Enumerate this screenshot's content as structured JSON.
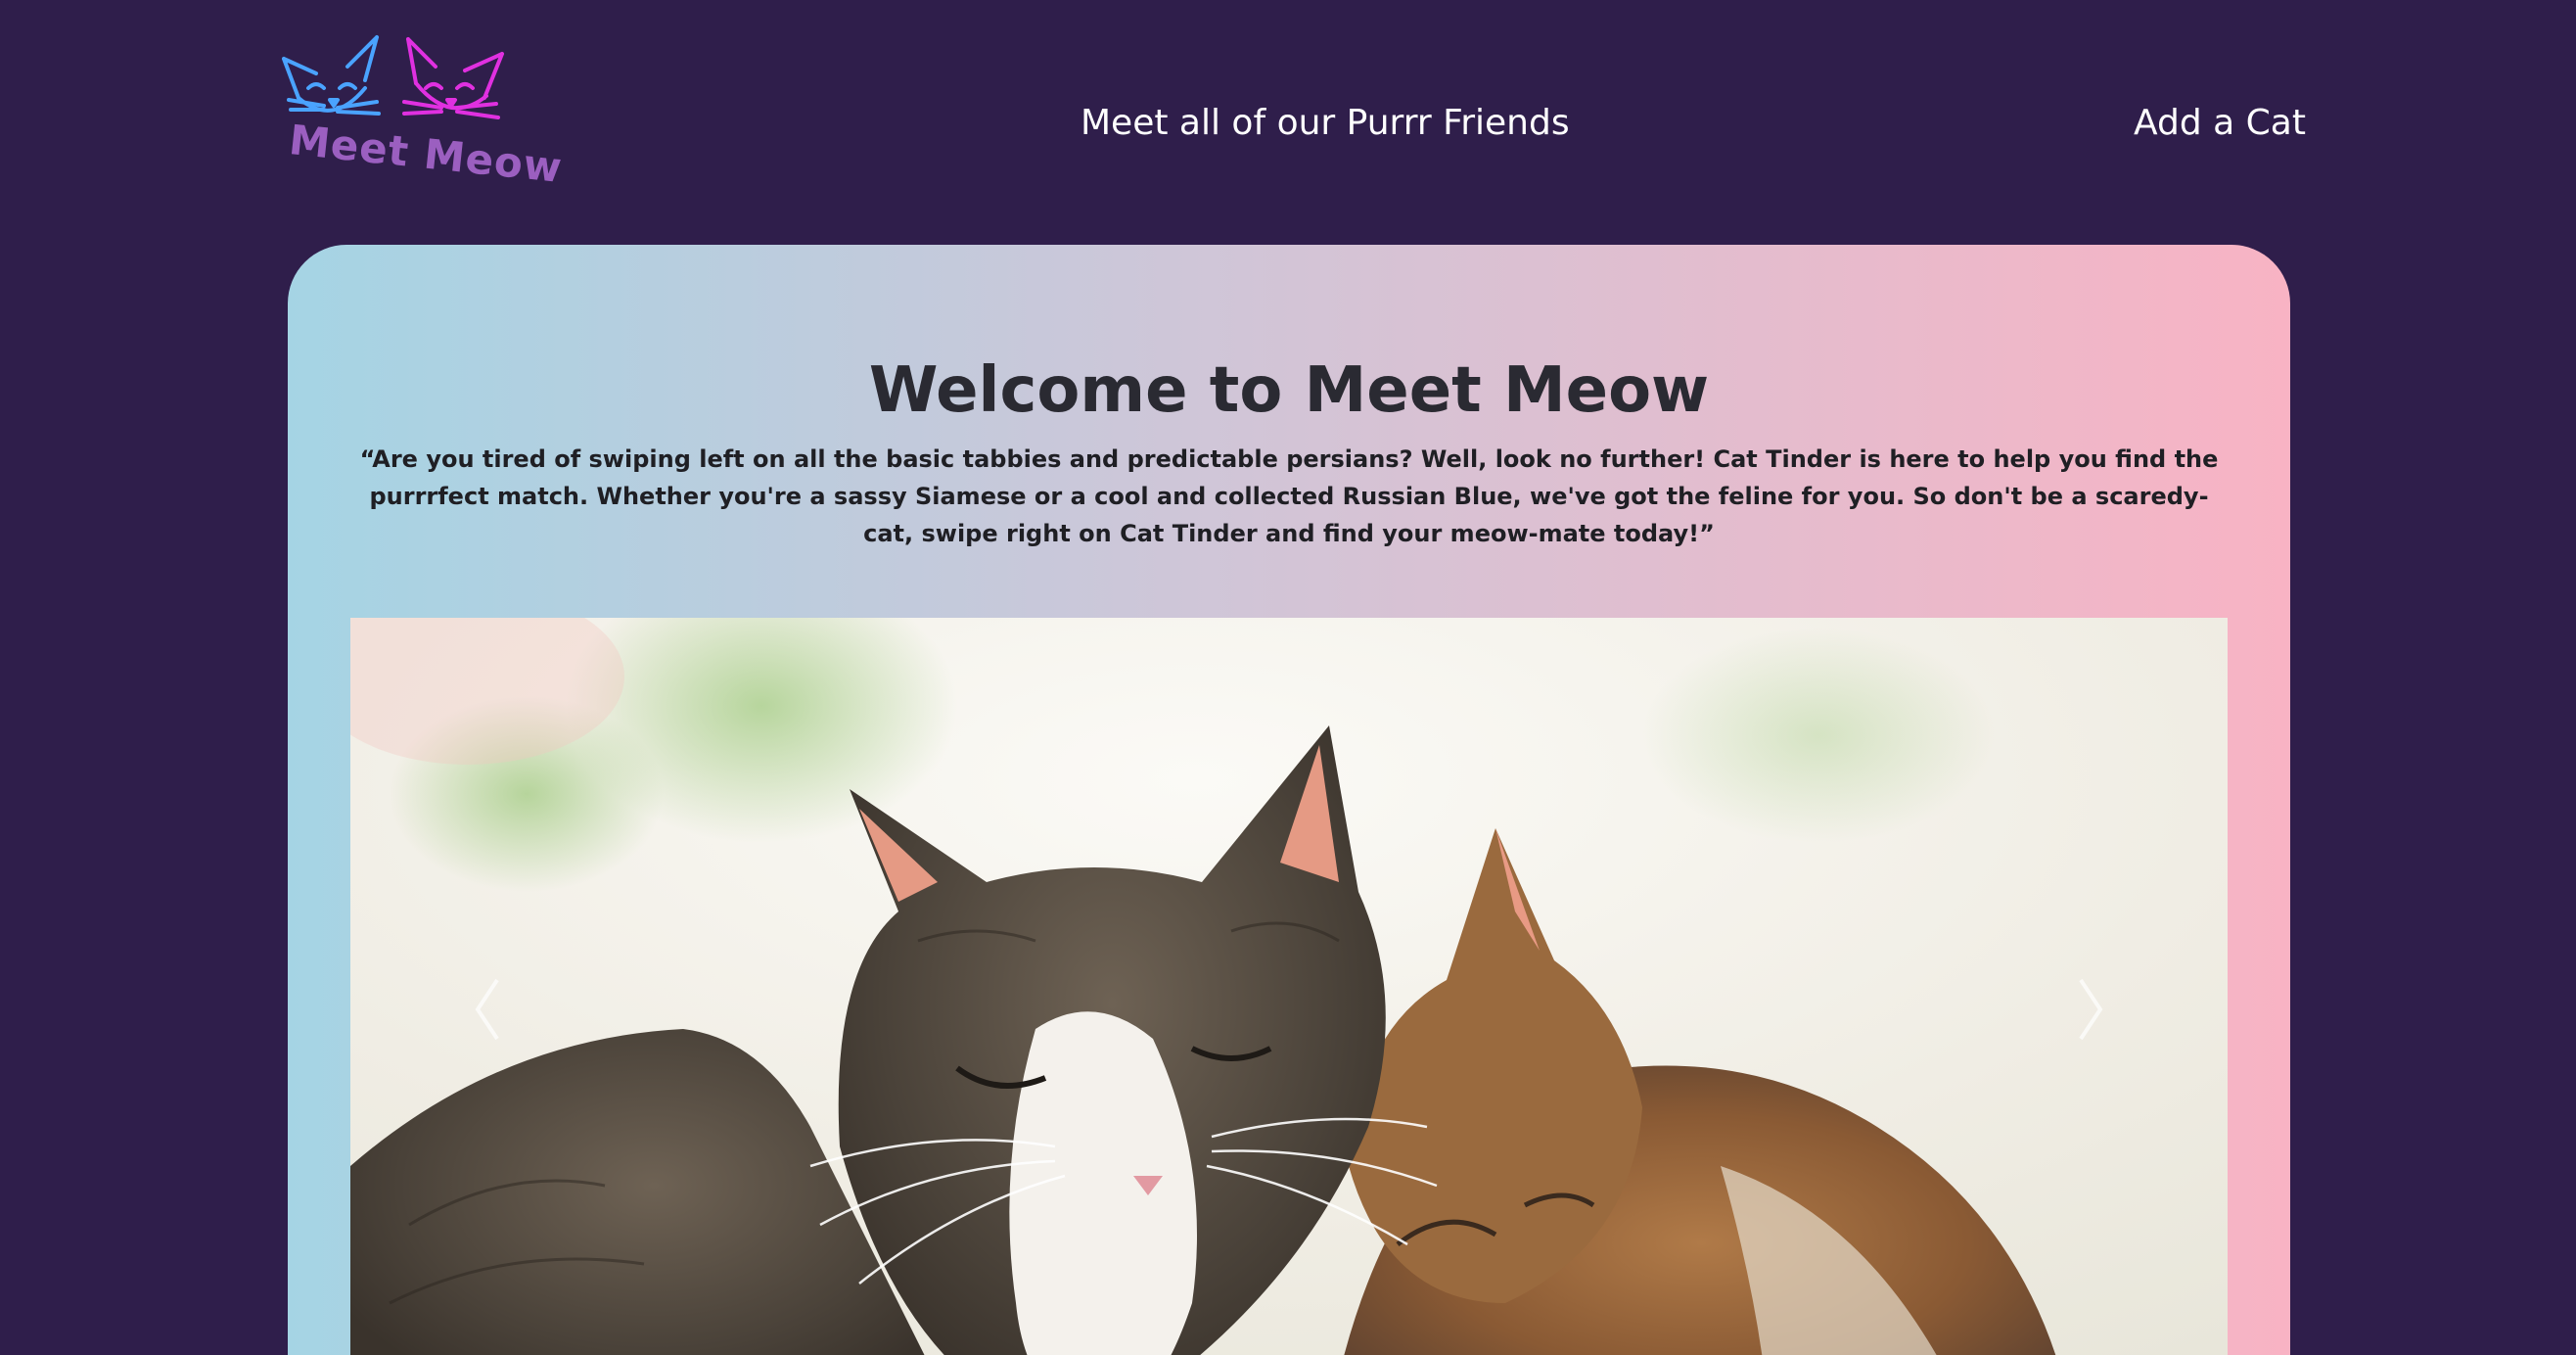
{
  "brand": {
    "logo_text": "Meet Meow"
  },
  "nav": {
    "friends_label": "Meet all of our Purrr Friends",
    "add_label": "Add a Cat"
  },
  "hero": {
    "title": "Welcome to Meet Meow",
    "quote": "“Are you tired of swiping left on all the basic tabbies and predictable persians? Well, look no further! Cat Tinder is here to help you find the purrrfect match. Whether you're a sassy Siamese or a cool and collected Russian Blue, we've got the feline for you. So don't be a scaredy-cat, swipe right on Cat Tinder and find your meow-mate today!”"
  },
  "carousel": {
    "prev_icon": "chevron-left-icon",
    "next_icon": "chevron-right-icon",
    "slide_subject": "two-sleeping-cats-photo"
  },
  "colors": {
    "background": "#2f1e4b",
    "gradient_start": "#a5d4e4",
    "gradient_end": "#f8b3c4",
    "logo_blue": "#4aa3ff",
    "logo_magenta": "#e030e0",
    "logo_text": "#9b5fc0"
  }
}
